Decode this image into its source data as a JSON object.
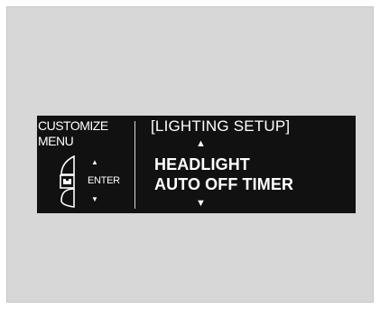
{
  "display": {
    "customize_menu_label": "CUSTOMIZE\nMENU",
    "menu_title": "[LIGHTING SETUP]",
    "option_lines": [
      "HEADLIGHT",
      "AUTO OFF TIMER"
    ],
    "enter_label": "ENTER",
    "scroll_up_symbol": "▲",
    "scroll_down_symbol": "▼",
    "knob_up_symbol": "▲",
    "knob_down_symbol": "▼",
    "colors": {
      "outer_panel": "#d7d7d7",
      "screen_bg": "#111111",
      "screen_text": "#ffffff"
    },
    "icons": {
      "selector_knob": "selector-knob-icon"
    }
  }
}
